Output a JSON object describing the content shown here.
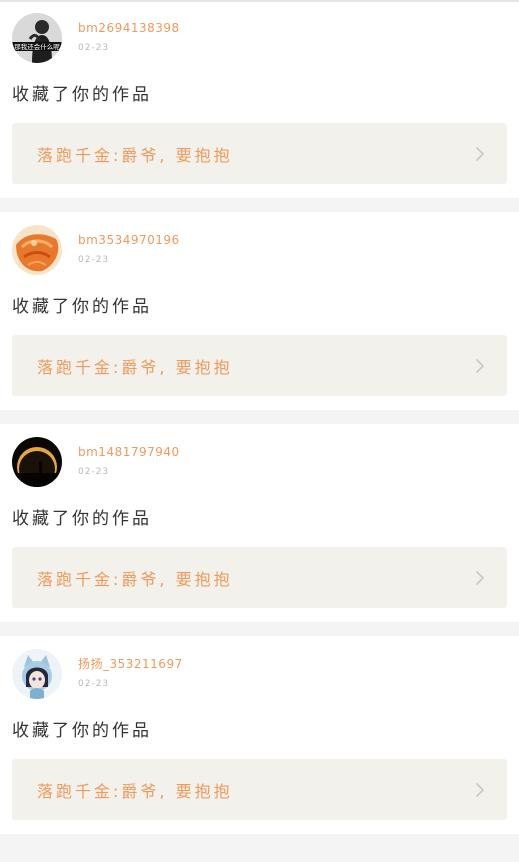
{
  "colors": {
    "accent": "#ee9a5e",
    "muted": "#b9b9b9",
    "text": "#333333",
    "box_bg": "#f3f1eb",
    "page_bg": "#f4f4f4"
  },
  "feed": {
    "items": [
      {
        "avatar": {
          "icon": "avatar-dark-figure",
          "caption": "那我还会什么呢"
        },
        "username": "bm2694138398",
        "time": "02-23",
        "action": "收藏了你的作品",
        "work_title": "落跑千金:爵爷, 要抱抱",
        "chevron_icon": "chevron-right-icon"
      },
      {
        "avatar": {
          "icon": "avatar-orange-food"
        },
        "username": "bm3534970196",
        "time": "02-23",
        "action": "收藏了你的作品",
        "work_title": "落跑千金:爵爷, 要抱抱",
        "chevron_icon": "chevron-right-icon"
      },
      {
        "avatar": {
          "icon": "avatar-eclipse-silhouette"
        },
        "username": "bm1481797940",
        "time": "02-23",
        "action": "收藏了你的作品",
        "work_title": "落跑千金:爵爷, 要抱抱",
        "chevron_icon": "chevron-right-icon"
      },
      {
        "avatar": {
          "icon": "avatar-anime-cat-girl"
        },
        "username": "扬扬_353211697",
        "time": "02-23",
        "action": "收藏了你的作品",
        "work_title": "落跑千金:爵爷, 要抱抱",
        "chevron_icon": "chevron-right-icon"
      }
    ]
  }
}
